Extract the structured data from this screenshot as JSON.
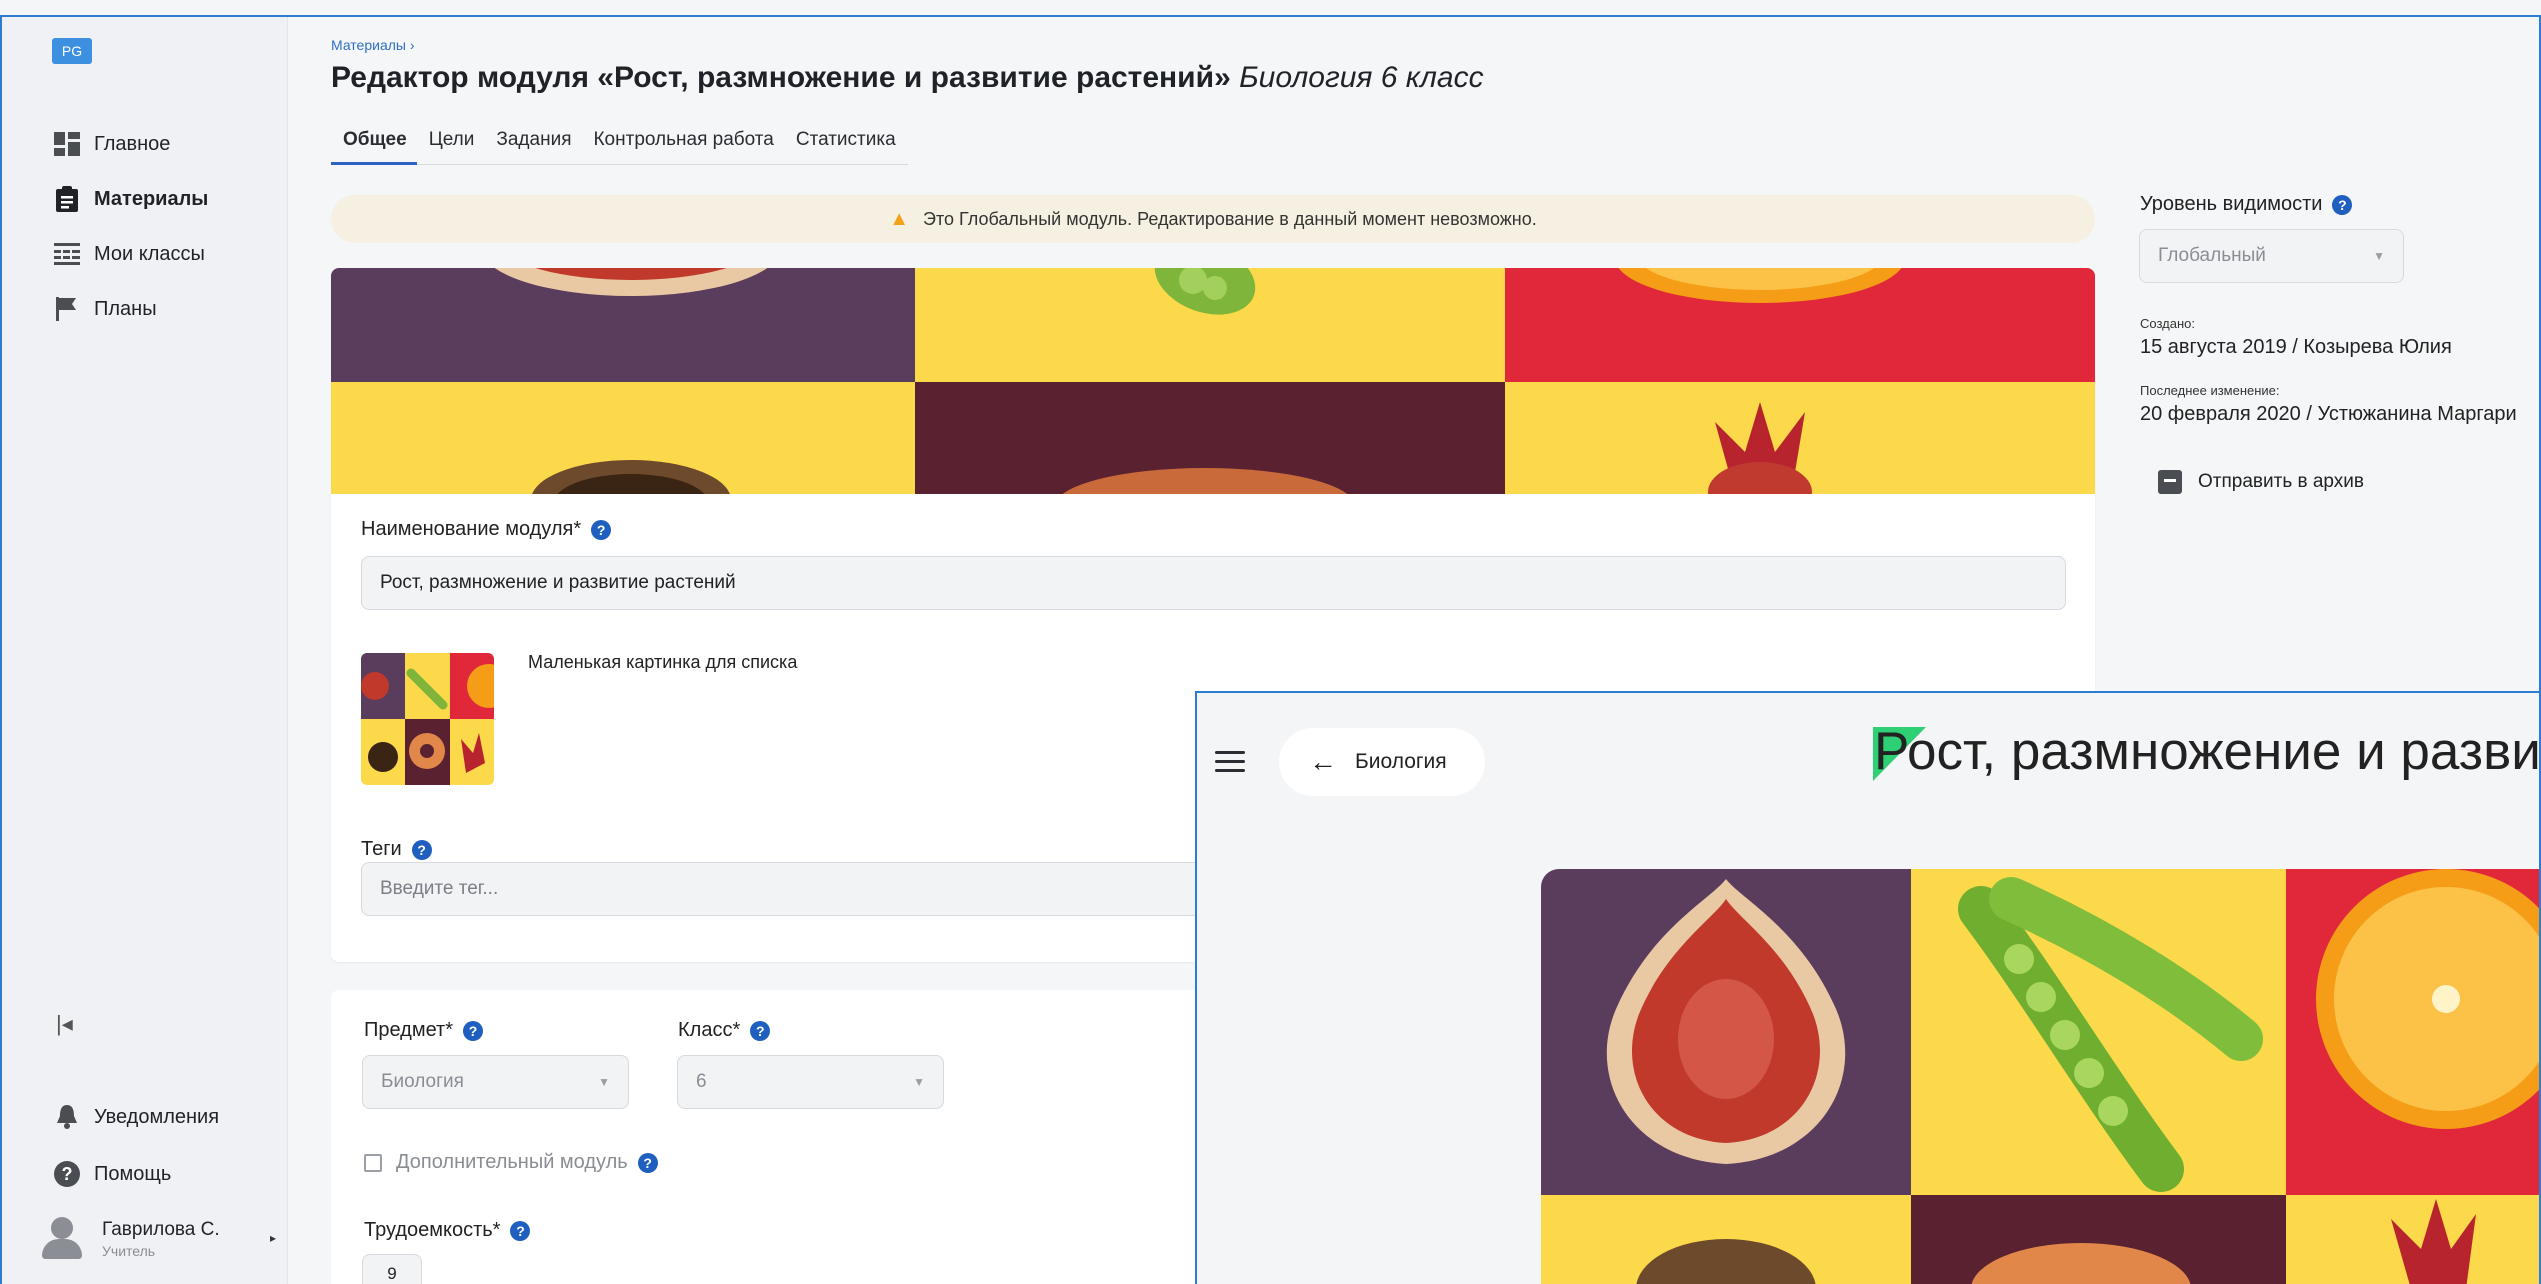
{
  "app": {
    "logo": "PG"
  },
  "sidebar": {
    "items": [
      {
        "label": "Главное",
        "icon": "dashboard-icon"
      },
      {
        "label": "Материалы",
        "icon": "clipboard-icon"
      },
      {
        "label": "Мои классы",
        "icon": "classes-icon"
      },
      {
        "label": "Планы",
        "icon": "flag-icon"
      }
    ],
    "bottom": [
      {
        "label": "Уведомления",
        "icon": "bell-icon"
      },
      {
        "label": "Помощь",
        "icon": "help-icon"
      }
    ],
    "user": {
      "name": "Гаврилова С.",
      "role": "Учитель"
    }
  },
  "header": {
    "breadcrumb": "Материалы ›",
    "title": "Редактор модуля «Рост, размножение и развитие растений»",
    "subject": "Биология 6 класс"
  },
  "tabs": [
    "Общее",
    "Цели",
    "Задания",
    "Контрольная работа",
    "Статистика"
  ],
  "warning": "Это Глобальный модуль. Редактирование в данный момент невозможно.",
  "form": {
    "name_label": "Наименование модуля*",
    "name_value": "Рост, размножение и развитие растений",
    "thumb_label": "Маленькая картинка для списка",
    "tags_label": "Теги",
    "tags_placeholder": "Введите тег...",
    "subject_label": "Предмет*",
    "subject_value": "Биология",
    "grade_label": "Класс*",
    "grade_value": "6",
    "extra_module_label": "Дополнительный модуль",
    "workload_label": "Трудоемкость*",
    "workload_value": "9"
  },
  "right_panel": {
    "visibility_label": "Уровень видимости",
    "visibility_value": "Глобальный",
    "created_label": "Создано:",
    "created_value": "15 августа 2019 / Козырева Юлия",
    "modified_label": "Последнее изменение:",
    "modified_value": "20 февраля 2020 / Устюжанина Маргари",
    "archive_label": "Отправить в архив"
  },
  "preview": {
    "back_label": "Биология",
    "title": "Рост, размножение и разви"
  },
  "colors": {
    "accent": "#2c62c3",
    "purple": "#5a3c5c",
    "yellow": "#fbd94a",
    "red": "#e1283a",
    "maroon": "#5a2130",
    "green_flag": "#2fcf74"
  }
}
